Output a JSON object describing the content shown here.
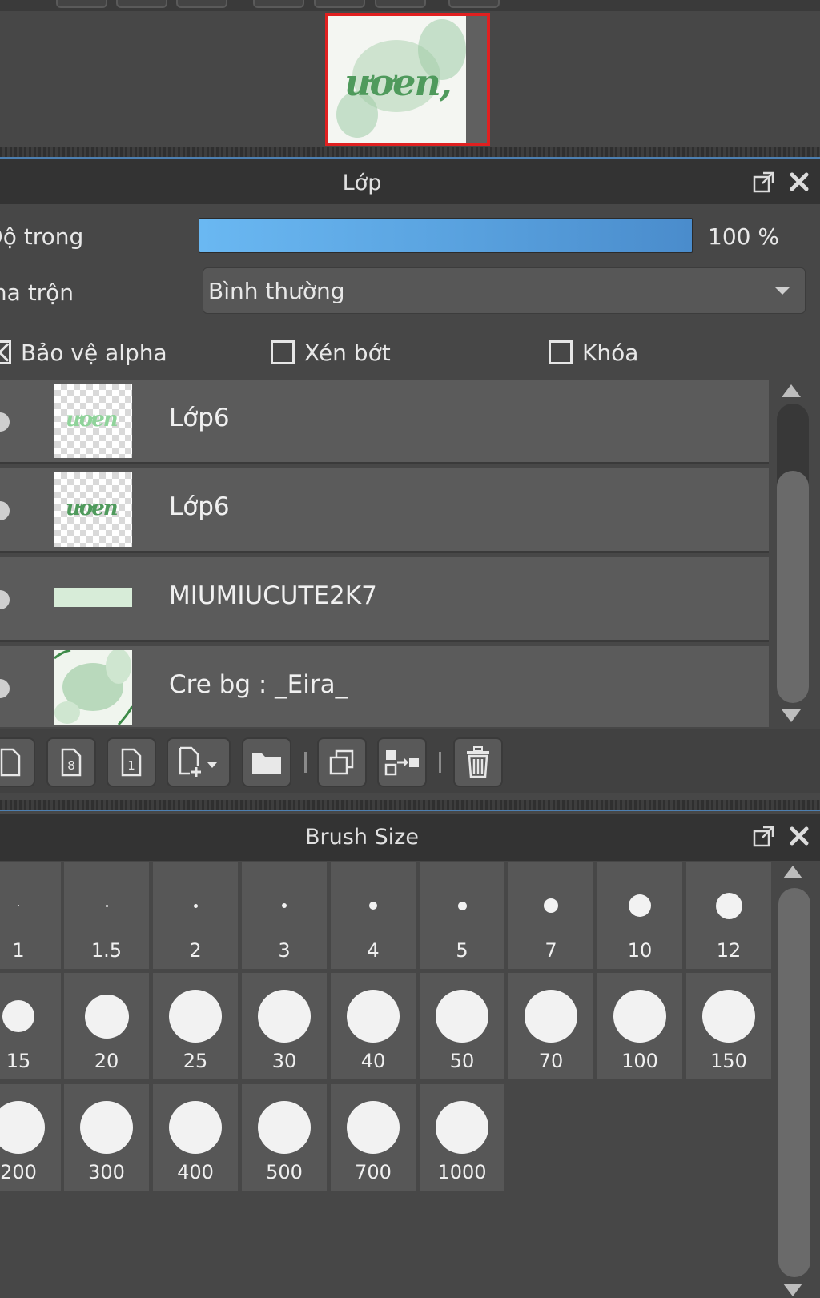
{
  "layer_panel": {
    "title": "Lớp",
    "opacity_label": "Độ trong",
    "opacity_value": "100 %",
    "opacity_percent": 100,
    "blend_label": "Pha trộn",
    "blend_value": "Bình thường",
    "protect_alpha": {
      "label": "Bảo vệ alpha",
      "checked": true
    },
    "clipping": {
      "label": "Xén bớt",
      "checked": false
    },
    "lock": {
      "label": "Khóa",
      "checked": false
    },
    "layers": [
      {
        "name": "Lớp6"
      },
      {
        "name": "Lớp6"
      },
      {
        "name": "MIUMIUCUTE2K7"
      },
      {
        "name": "Cre bg : _Eira_"
      }
    ]
  },
  "brush_panel": {
    "title": "Brush Size",
    "sizes": [
      "1",
      "1.5",
      "2",
      "3",
      "4",
      "5",
      "7",
      "10",
      "12",
      "15",
      "20",
      "25",
      "30",
      "40",
      "50",
      "70",
      "100",
      "150",
      "200",
      "300",
      "400",
      "500",
      "700",
      "1000"
    ]
  },
  "colors": {
    "selection_frame": "#e02020",
    "opacity_bar": "#5aa3e0",
    "thumb_text_light": "#8fd39a",
    "thumb_text_dark": "#4f9a5c"
  },
  "icons": {
    "popout": "popout-icon",
    "close": "close-icon"
  }
}
